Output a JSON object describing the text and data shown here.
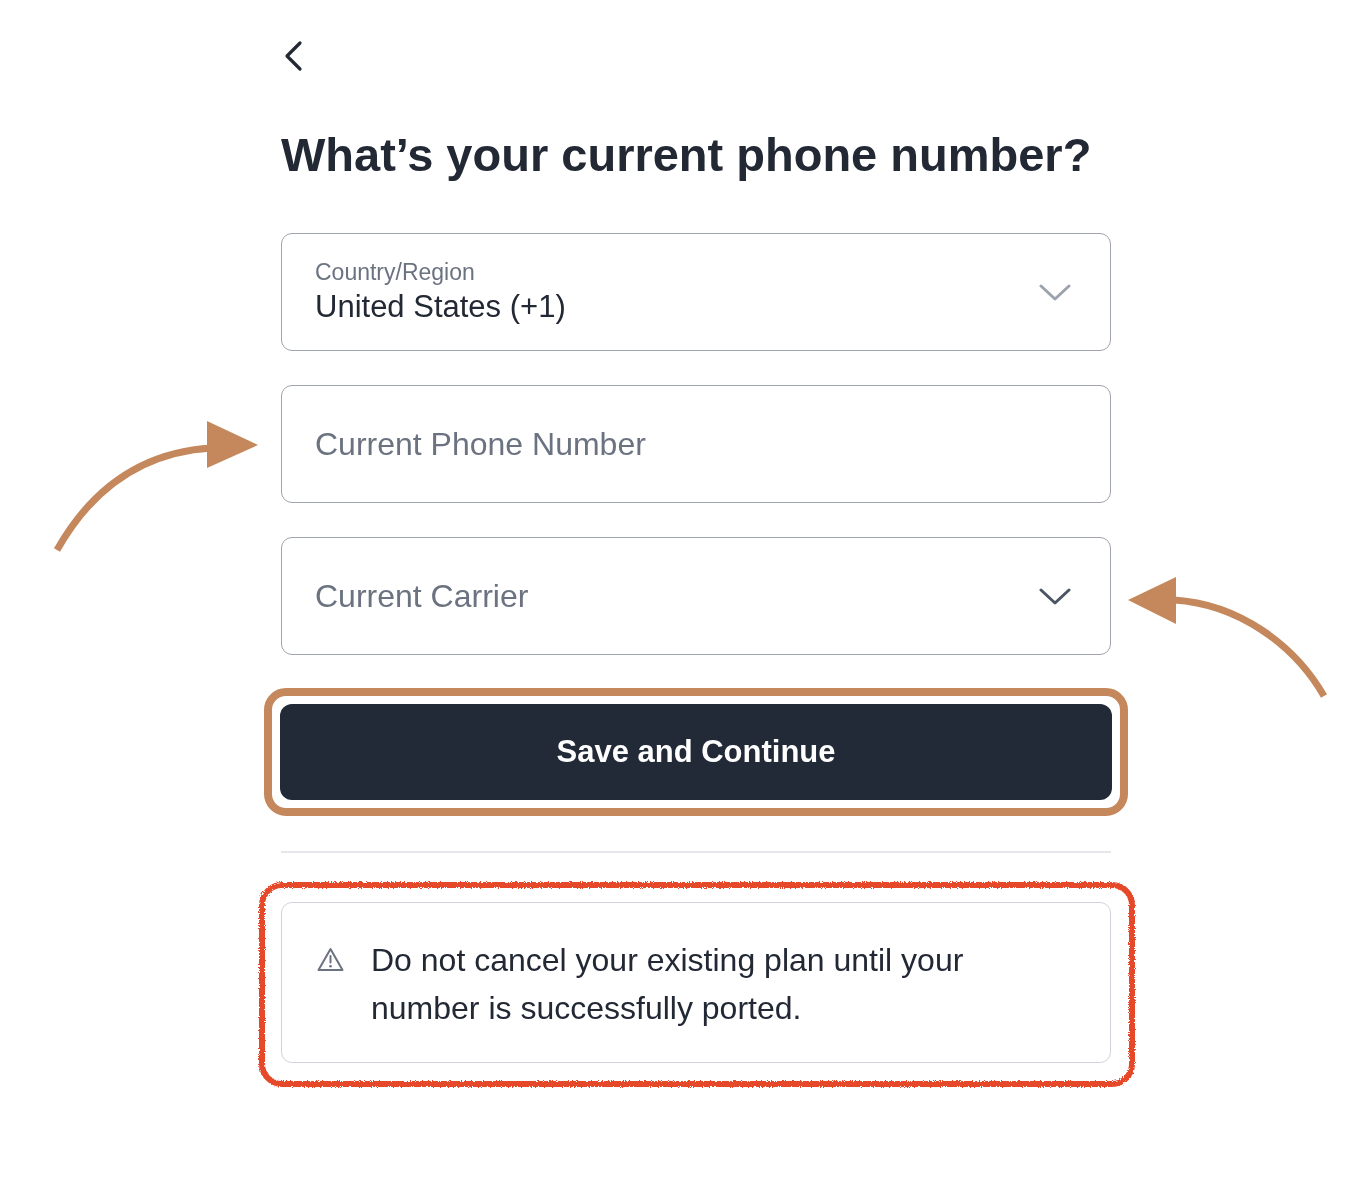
{
  "heading": "What’s your current phone number?",
  "fields": [
    {
      "kind": "select",
      "label": "Country/Region",
      "value": "United States (+1)",
      "arrow_left": false,
      "arrow_right": false
    },
    {
      "kind": "input",
      "placeholder": "Current Phone Number",
      "arrow_left": true,
      "arrow_right": false
    },
    {
      "kind": "select",
      "placeholder": "Current Carrier",
      "arrow_left": false,
      "arrow_right": true
    }
  ],
  "button": {
    "label": "Save and Continue",
    "highlight": true
  },
  "notice": {
    "text": "Do not cancel your existing plan until your number is successfully ported.",
    "highlight": true
  }
}
